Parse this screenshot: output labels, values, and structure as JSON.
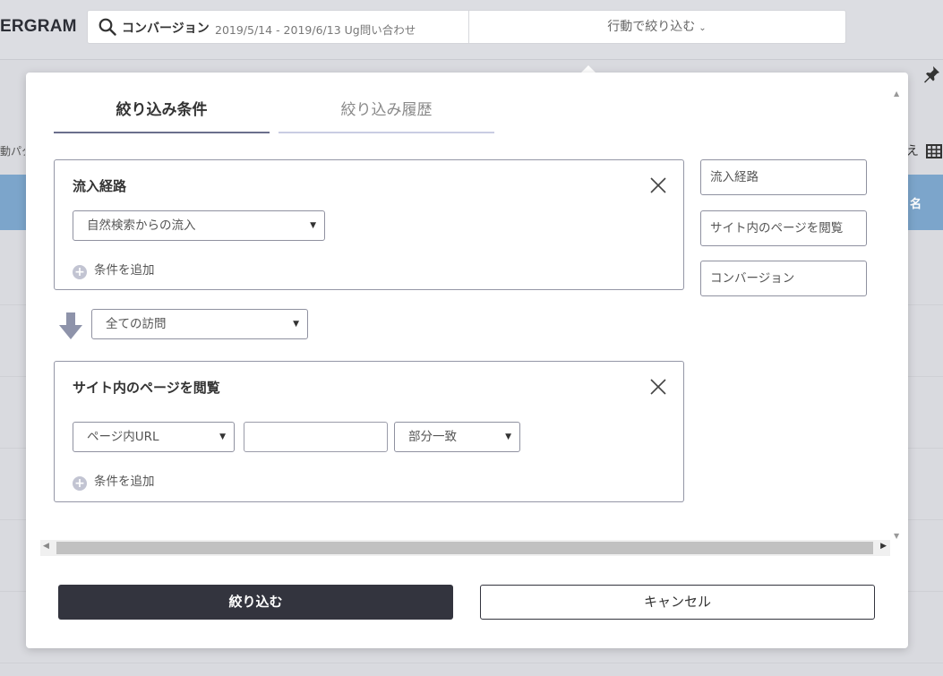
{
  "app": {
    "logo": "ERGRAM"
  },
  "search": {
    "category": "コンバージョン",
    "range": "2019/5/14 - 2019/6/13 Ug問い合わせ",
    "filter_action": "行動で絞り込む",
    "chevron": "⌄"
  },
  "background": {
    "left_snippet": "動パタ",
    "right_header": "名",
    "right_e": "え"
  },
  "modal": {
    "tabs": [
      {
        "label": "絞り込み条件"
      },
      {
        "label": "絞り込み履歴"
      }
    ],
    "card1": {
      "title": "流入経路",
      "select_value": "自然検索からの流入",
      "add_condition": "条件を追加"
    },
    "connector": {
      "select_value": "全ての訪問"
    },
    "card2": {
      "title": "サイト内のページを閲覧",
      "select_field": "ページ内URL",
      "text_value": "",
      "select_match": "部分一致",
      "add_condition": "条件を追加"
    },
    "side_buttons": [
      {
        "label": "流入経路"
      },
      {
        "label": "サイト内のページを閲覧"
      },
      {
        "label": "コンバージョン"
      }
    ],
    "apply_label": "絞り込む",
    "cancel_label": "キャンセル"
  }
}
